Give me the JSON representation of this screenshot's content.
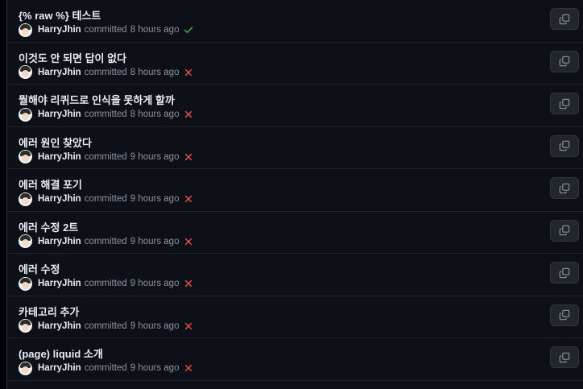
{
  "commits": [
    {
      "title": "{% raw %} 테스트",
      "author": "HarryJhin",
      "action": "committed",
      "time": "8 hours ago",
      "status": "success",
      "status_icon": "check-icon"
    },
    {
      "title": "이것도 안 되면 답이 없다",
      "author": "HarryJhin",
      "action": "committed",
      "time": "8 hours ago",
      "status": "failure",
      "status_icon": "x-icon"
    },
    {
      "title": "뭘해야 리퀴드로 인식을 못하게 할까",
      "author": "HarryJhin",
      "action": "committed",
      "time": "8 hours ago",
      "status": "failure",
      "status_icon": "x-icon"
    },
    {
      "title": "에러 원인 찾았다",
      "author": "HarryJhin",
      "action": "committed",
      "time": "9 hours ago",
      "status": "failure",
      "status_icon": "x-icon"
    },
    {
      "title": "에러 해결 포기",
      "author": "HarryJhin",
      "action": "committed",
      "time": "9 hours ago",
      "status": "failure",
      "status_icon": "x-icon"
    },
    {
      "title": "에러 수정 2트",
      "author": "HarryJhin",
      "action": "committed",
      "time": "9 hours ago",
      "status": "failure",
      "status_icon": "x-icon"
    },
    {
      "title": "에러 수정",
      "author": "HarryJhin",
      "action": "committed",
      "time": "9 hours ago",
      "status": "failure",
      "status_icon": "x-icon"
    },
    {
      "title": "카테고리 추가",
      "author": "HarryJhin",
      "action": "committed",
      "time": "9 hours ago",
      "status": "failure",
      "status_icon": "x-icon"
    },
    {
      "title": "(page) liquid 소개",
      "author": "HarryJhin",
      "action": "committed",
      "time": "9 hours ago",
      "status": "failure",
      "status_icon": "x-icon"
    }
  ],
  "colors": {
    "success": "#3fb950",
    "failure": "#f85149",
    "background": "#0d1117",
    "muted_text": "#8b949e"
  },
  "copy_icon": "copy-icon"
}
